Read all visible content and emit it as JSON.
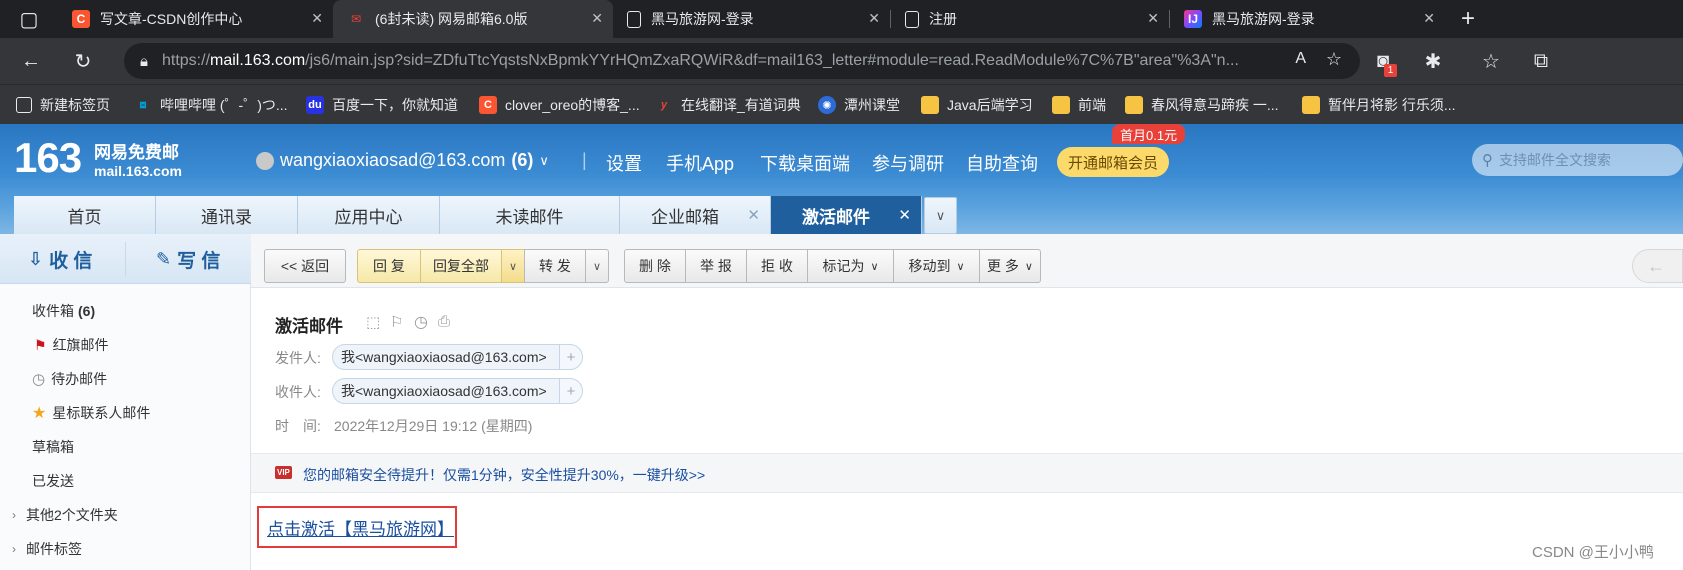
{
  "browser": {
    "tabs": [
      {
        "title": "写文章-CSDN创作中心",
        "icon": "csdn-icon",
        "active": false
      },
      {
        "title": "(6封未读) 网易邮箱6.0版",
        "icon": "163-mail-icon",
        "active": true
      },
      {
        "title": "黑马旅游网-登录",
        "icon": "page-icon",
        "active": false
      },
      {
        "title": "注册",
        "icon": "page-icon",
        "active": false
      },
      {
        "title": "黑马旅游网-登录",
        "icon": "ide-icon",
        "active": false
      }
    ],
    "url_prefix": "https://",
    "url_host": "mail.163.com",
    "url_rest": "/js6/main.jsp?sid=ZDfuTtcYqstsNxBpmkYYrHQmZxaRQWiR&df=mail163_letter#module=read.ReadModule%7C%7B\"area\"%3A\"n...",
    "extension_badge": "1",
    "bookmarks": [
      {
        "label": "新建标签页",
        "icon": "grid-icon"
      },
      {
        "label": "哔哩哔哩 (゜-゜)つ...",
        "icon": "bilibili-icon"
      },
      {
        "label": "百度一下，你就知道",
        "icon": "baidu-icon"
      },
      {
        "label": "clover_oreo的博客_...",
        "icon": "csdn-icon"
      },
      {
        "label": "在线翻译_有道词典",
        "icon": "youdao-icon"
      },
      {
        "label": "潭州课堂",
        "icon": "tanzhou-icon"
      },
      {
        "label": "Java后端学习",
        "icon": "folder-icon"
      },
      {
        "label": "前端",
        "icon": "folder-icon"
      },
      {
        "label": "春风得意马蹄疾 一...",
        "icon": "folder-icon"
      },
      {
        "label": "暂伴月将影 行乐须...",
        "icon": "folder-icon"
      }
    ]
  },
  "mail_header": {
    "logo_number": "163",
    "logo_name": "网易免费邮",
    "logo_domain": "mail.163.com",
    "account": "wangxiaoxiaosad@163.com",
    "unread_count": "(6)",
    "nav": [
      "设置",
      "手机App",
      "下载桌面端",
      "参与调研",
      "自助查询"
    ],
    "vip_button": "开通邮箱会员",
    "vip_badge": "首月0.1元",
    "search_placeholder": "支持邮件全文搜索"
  },
  "mail_tabs": [
    {
      "label": "首页",
      "closable": false
    },
    {
      "label": "通讯录",
      "closable": false
    },
    {
      "label": "应用中心",
      "closable": false
    },
    {
      "label": "未读邮件",
      "closable": false
    },
    {
      "label": "企业邮箱",
      "closable": true
    },
    {
      "label": "激活邮件",
      "closable": true,
      "active": true
    }
  ],
  "sidebar": {
    "receive": "收 信",
    "compose": "写 信",
    "folders": [
      {
        "label": "收件箱",
        "count": "(6)"
      },
      {
        "label": "红旗邮件",
        "icon": "red-flag-icon"
      },
      {
        "label": "待办邮件",
        "icon": "clock-icon"
      },
      {
        "label": "星标联系人邮件",
        "icon": "star-icon"
      },
      {
        "label": "草稿箱"
      },
      {
        "label": "已发送"
      },
      {
        "label": "其他2个文件夹",
        "expandable": true
      },
      {
        "label": "邮件标签",
        "expandable": true
      }
    ]
  },
  "actions": {
    "back": "<< 返回",
    "reply": "回 复",
    "reply_all": "回复全部",
    "forward": "转 发",
    "delete": "删 除",
    "report": "举 报",
    "reject": "拒 收",
    "mark_as": "标记为",
    "move_to": "移动到",
    "more": "更 多"
  },
  "mail": {
    "subject": "激活邮件",
    "from_label": "发件人:",
    "from": "我<wangxiaoxiaosad@163.com>",
    "to_label": "收件人:",
    "to": "我<wangxiaoxiaosad@163.com>",
    "time_label": "时　间:",
    "time": "2022年12月29日 19:12 (星期四)",
    "security_notice": "您的邮箱安全待提升！仅需1分钟，安全性提升30%，一键升级>>",
    "vip_tag": "VIP",
    "body_link": "点击激活【黑马旅游网】"
  },
  "watermark": "CSDN @王小小鸭"
}
